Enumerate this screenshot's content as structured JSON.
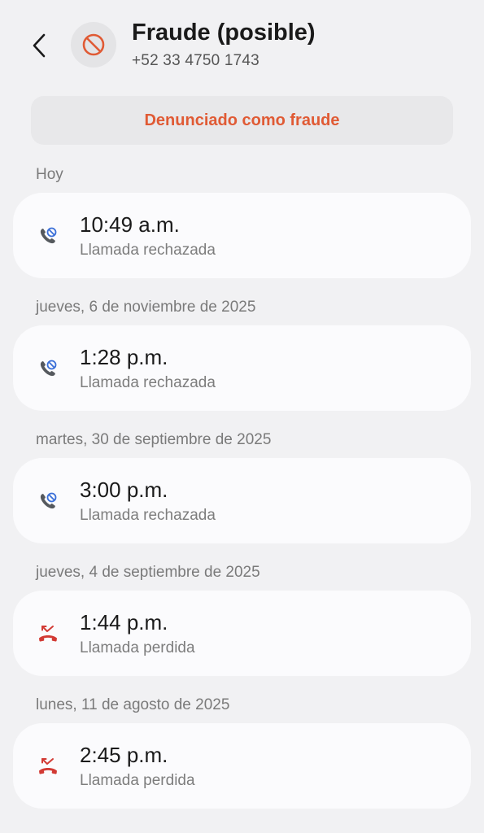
{
  "header": {
    "title": "Fraude (posible)",
    "phone": "+52 33 4750 1743"
  },
  "banner": {
    "label": "Denunciado como fraude"
  },
  "accent_color": "#e05a34",
  "calls": [
    {
      "date": "Hoy",
      "time": "10:49 a.m.",
      "status": "Llamada rechazada",
      "icon": "rejected-call-icon"
    },
    {
      "date": "jueves, 6 de noviembre de 2025",
      "time": "1:28 p.m.",
      "status": "Llamada rechazada",
      "icon": "rejected-call-icon"
    },
    {
      "date": "martes, 30 de septiembre de 2025",
      "time": "3:00 p.m.",
      "status": "Llamada rechazada",
      "icon": "rejected-call-icon"
    },
    {
      "date": "jueves, 4 de septiembre de 2025",
      "time": "1:44 p.m.",
      "status": "Llamada perdida",
      "icon": "missed-call-icon"
    },
    {
      "date": "lunes, 11 de agosto de 2025",
      "time": "2:45 p.m.",
      "status": "Llamada perdida",
      "icon": "missed-call-icon"
    }
  ]
}
